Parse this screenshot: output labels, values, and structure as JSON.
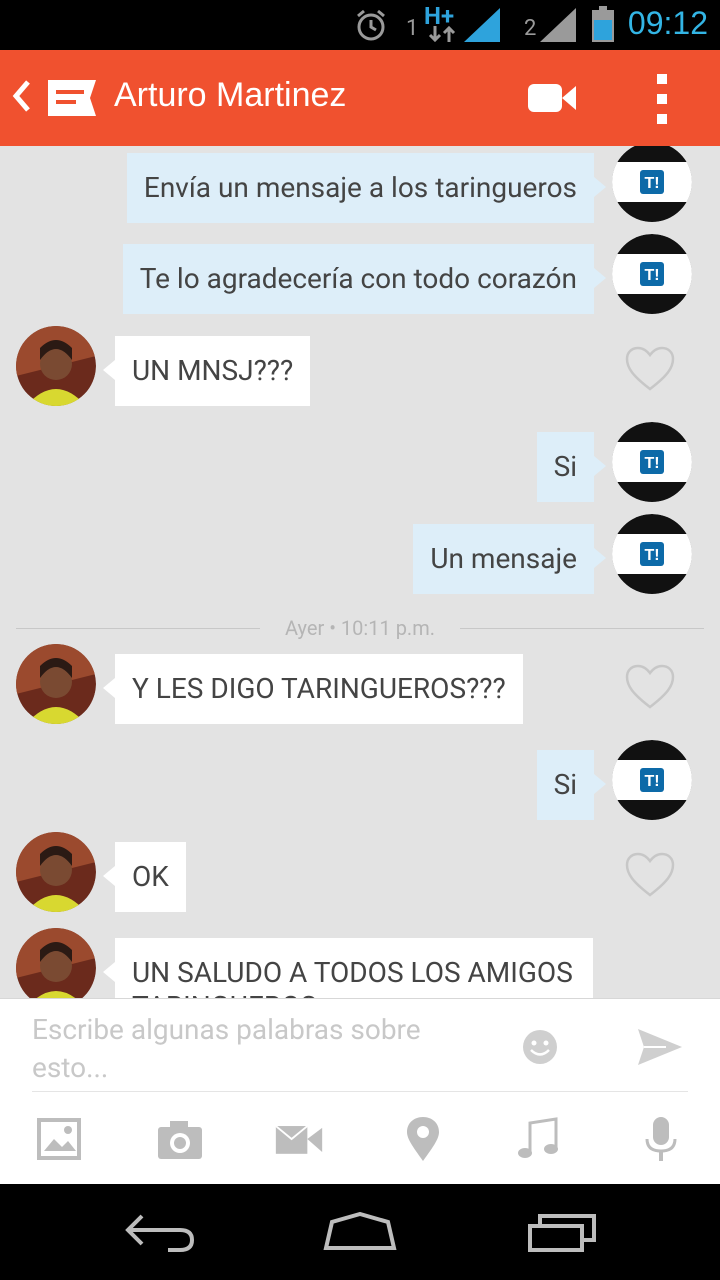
{
  "status_bar": {
    "time": "09:12",
    "sim1": "1",
    "sim2": "2",
    "network": "H+"
  },
  "header": {
    "title": "Arturo Martinez"
  },
  "messages": [
    {
      "dir": "out",
      "text": "Envía un mensaje a los taringueros"
    },
    {
      "dir": "out",
      "text": "Te lo agradecería con todo corazón"
    },
    {
      "dir": "in",
      "text": "UN MNSJ???"
    },
    {
      "dir": "out",
      "text": "Si"
    },
    {
      "dir": "out",
      "text": "Un mensaje"
    },
    {
      "dir": "in",
      "text": "Y LES DIGO TARINGUEROS???"
    },
    {
      "dir": "out",
      "text": "Si"
    },
    {
      "dir": "in",
      "text": "OK"
    },
    {
      "dir": "in",
      "text": "UN SALUDO A TODOS LOS AMIGOS TARINGUEROS"
    }
  ],
  "divider": {
    "label": "Ayer • 10:11 p.m."
  },
  "composer": {
    "placeholder": "Escribe algunas palabras sobre esto..."
  },
  "brand_avatar_text": "T!",
  "colors": {
    "appbar": "#f0512f",
    "outgoing_bubble": "#ddeef9",
    "incoming_bubble": "#ffffff",
    "background": "#e3e3e3"
  }
}
